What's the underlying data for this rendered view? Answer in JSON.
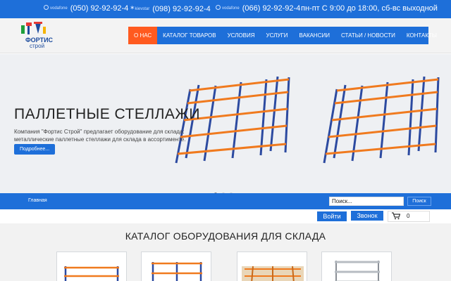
{
  "topbar": {
    "phones": [
      {
        "operator": "vodafone",
        "number": "(050) 92-92-92-4"
      },
      {
        "operator": "kievstar",
        "number": "(098) 92-92-92-4"
      },
      {
        "operator": "vodafone",
        "number": "(066) 92-92-92-4"
      }
    ],
    "hours": "пн-пт С 9:00 до 18:00, сб-вс выходной"
  },
  "logo": {
    "line1": "ФОРТИС",
    "line2": "строй"
  },
  "nav": {
    "items": [
      {
        "label": "О НАС",
        "active": true
      },
      {
        "label": "КАТАЛОГ ТОВАРОВ"
      },
      {
        "label": "УСЛОВИЯ"
      },
      {
        "label": "УСЛУГИ"
      },
      {
        "label": "ВАКАНСИИ"
      },
      {
        "label": "СТАТЬИ / НОВОСТИ"
      },
      {
        "label": "КОНТАКТЫ"
      }
    ]
  },
  "hero": {
    "title": "ПАЛЛЕТНЫЕ СТЕЛЛАЖИ",
    "description": "Компания \"Фортис Строй\" предлагает оборудование для склада: металлические паллетные стеллажи для склада в ассортименте.",
    "more_label": "Подробнее...",
    "active_slide": 1,
    "slides": 3
  },
  "breadcrumb": {
    "home": "Главная"
  },
  "search": {
    "value": "Поиск...",
    "button": "Поиск"
  },
  "actions": {
    "login": "Войти",
    "call": "Звонок",
    "cart_count": "0"
  },
  "catalog": {
    "title": "КАТАЛОГ ОБОРУДОВАНИЯ ДЛЯ СКЛАДА"
  },
  "colors": {
    "primary": "#1e6fd9",
    "accent": "#ff5a1f",
    "beam": "#f07a1e",
    "upright": "#2c4aa0"
  }
}
